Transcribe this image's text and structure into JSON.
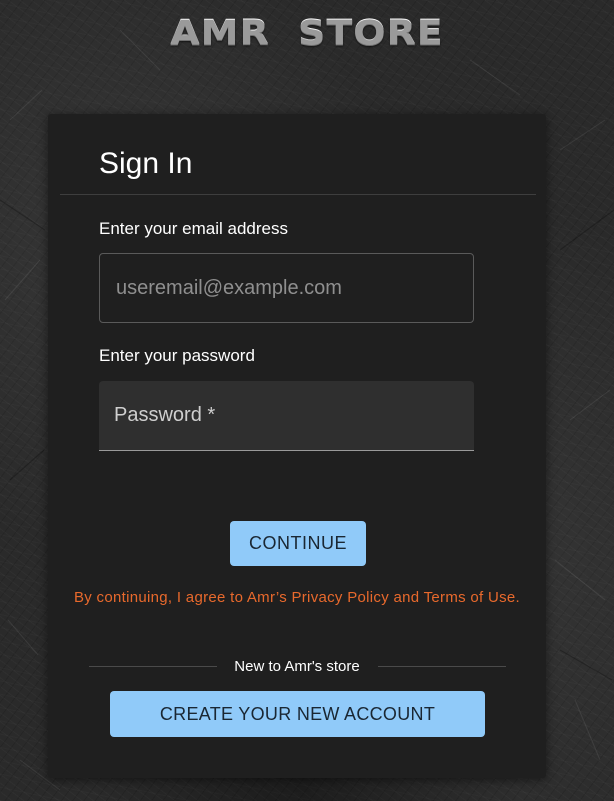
{
  "header": {
    "logo_text": "AMR STORE"
  },
  "signin": {
    "title": "Sign In",
    "email_label": "Enter your email address",
    "email_placeholder": "useremail@example.com",
    "email_value": "",
    "password_label": "Enter your password",
    "password_field_label": "Password *",
    "password_value": "",
    "continue_label": "CONTINUE",
    "terms_text": "By continuing, I agree to Amr’s Privacy Policy and Terms of Use.",
    "new_user_text": "New to Amr's store",
    "create_account_label": "CREATE YOUR NEW ACCOUNT"
  },
  "colors": {
    "accent": "#90caf9",
    "terms_text": "#e8692c",
    "card_background": "#1f1f1f",
    "page_background": "#2a2a2a"
  }
}
